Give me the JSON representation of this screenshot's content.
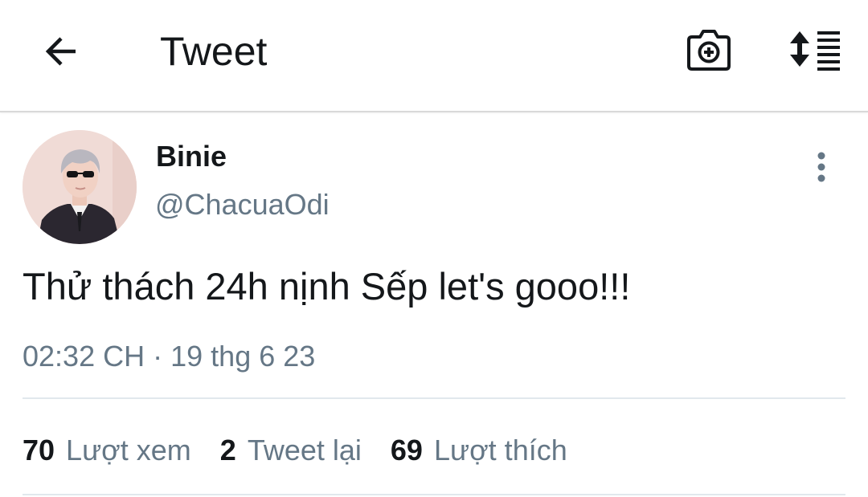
{
  "header": {
    "title": "Tweet",
    "icons": {
      "back": "back-arrow-icon",
      "camera": "camera-plus-icon",
      "sort": "sort-list-icon"
    }
  },
  "tweet": {
    "author": {
      "display_name": "Binie",
      "handle": "@ChacuaOdi",
      "avatar": "avatar-photo"
    },
    "text": "Thử thách 24h nịnh Sếp let's gooo!!!",
    "time": "02:32 CH",
    "separator": "·",
    "date": "19 thg 6 23"
  },
  "stats": [
    {
      "count": "70",
      "label": "Lượt xem"
    },
    {
      "count": "2",
      "label": "Tweet lại"
    },
    {
      "count": "69",
      "label": "Lượt thích"
    }
  ],
  "colors": {
    "text_primary": "#14171a",
    "text_secondary": "#657786",
    "divider": "#e1e8ed",
    "background": "#ffffff"
  }
}
